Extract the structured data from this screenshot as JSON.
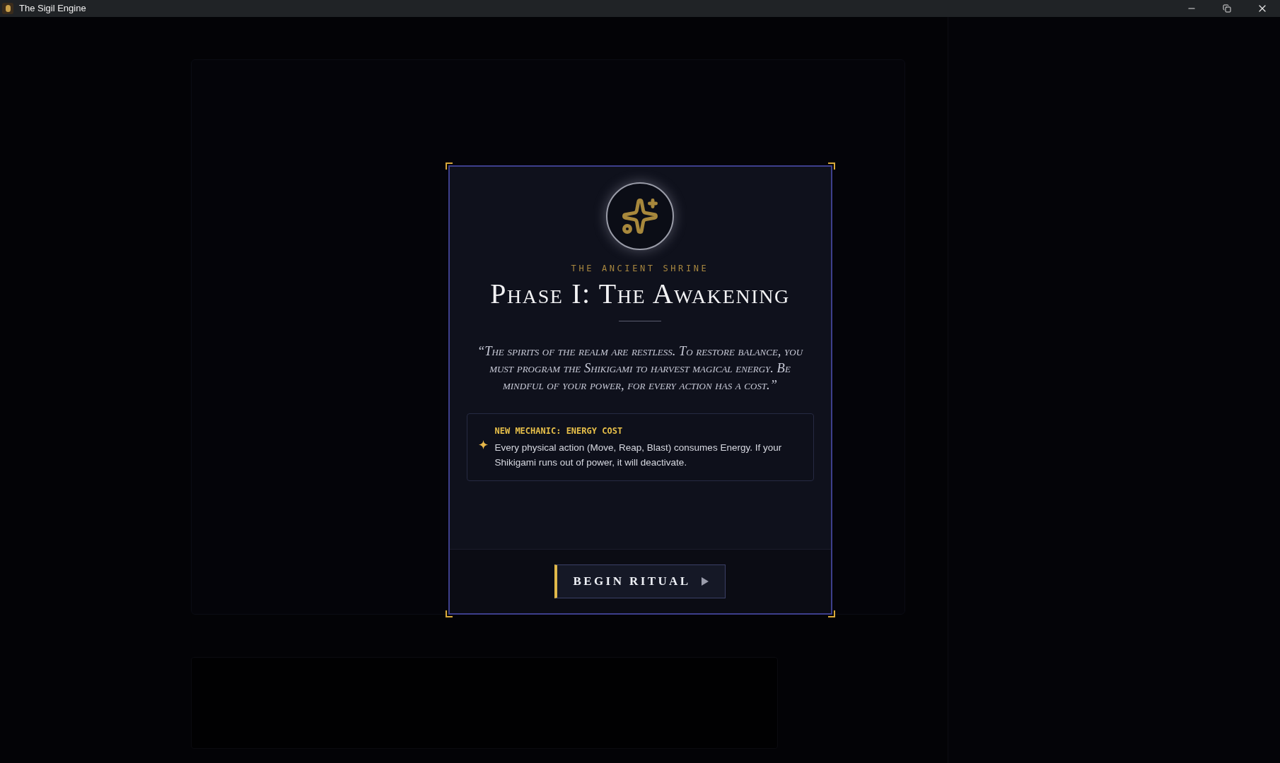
{
  "window": {
    "title": "The Sigil Engine"
  },
  "dialog": {
    "eyebrow": "THE ANCIENT SHRINE",
    "title": "Phase I: The Awakening",
    "quote": "“The spirits of the realm are restless. To restore balance, you must program the Shikigami to harvest magical energy. Be mindful of your power, for every action has a cost.”",
    "notice": {
      "heading": "NEW MECHANIC: ENERGY COST",
      "body": "Every physical action (Move, Reap, Blast) consumes Energy. If your Shikigami runs out of power, it will deactivate."
    },
    "button": {
      "label": "BEGIN RITUAL"
    }
  }
}
